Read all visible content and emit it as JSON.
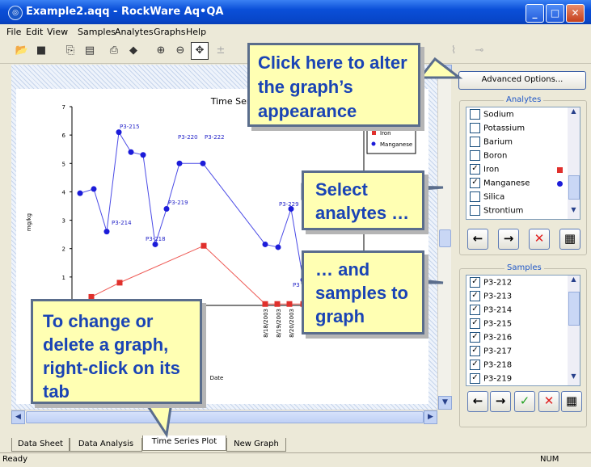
{
  "window": {
    "title": "Example2.aqq - RockWare Aq•QA",
    "app_icon": "RockWare compass logo",
    "min": "_",
    "max": "□",
    "close": "✕"
  },
  "menu": [
    "File",
    "Edit",
    "View",
    "Samples",
    "Analytes",
    "Graphs",
    "Help"
  ],
  "toolbar": {
    "icons": [
      "open-folder-icon",
      "save-icon",
      "copy-icon",
      "paste-icon",
      "print-icon",
      "eraser-icon",
      "zoom-in-icon",
      "zoom-out-icon",
      "pan-icon"
    ]
  },
  "chart_data": {
    "type": "line",
    "title": "Time Series Plot",
    "xlabel": "Date",
    "ylabel": "mg/kg",
    "ylim": [
      0,
      7
    ],
    "yticks": [
      "1",
      "2",
      "3",
      "4",
      "5",
      "6",
      "7"
    ],
    "x_tick_labels": [
      "8/18/2003",
      "8/19/2003",
      "8/20/2003"
    ],
    "legend": {
      "placement": "top-right",
      "entries": [
        "Iron",
        "Manganese"
      ]
    },
    "series": [
      {
        "name": "Manganese",
        "color": "#1c1cd9",
        "values": [
          3.95,
          4.1,
          2.6,
          6.1,
          5.4,
          5.3,
          2.15,
          3.4,
          5.0,
          5.0,
          2.15,
          2.05,
          3.4,
          0.9
        ]
      },
      {
        "name": "Iron",
        "color": "#e0302c",
        "values": [
          0.3,
          0.8,
          2.1,
          0.05,
          0.05,
          0.05,
          0.05
        ]
      }
    ],
    "point_labels": [
      "P3-214",
      "P3-215",
      "P3-218",
      "P3-219",
      "P3-220",
      "P3-222",
      "P3-229",
      "P3"
    ]
  },
  "sidebar": {
    "advanced_button": "Advanced Options...",
    "analytes_title": "Analytes",
    "analytes": [
      {
        "label": "Sodium",
        "checked": false,
        "marker": ""
      },
      {
        "label": "Potassium",
        "checked": false,
        "marker": ""
      },
      {
        "label": "Barium",
        "checked": false,
        "marker": ""
      },
      {
        "label": "Boron",
        "checked": false,
        "marker": ""
      },
      {
        "label": "Iron",
        "checked": true,
        "marker": "square-red"
      },
      {
        "label": "Manganese",
        "checked": true,
        "marker": "circle-blue"
      },
      {
        "label": "Silica",
        "checked": false,
        "marker": ""
      },
      {
        "label": "Strontium",
        "checked": false,
        "marker": ""
      }
    ],
    "analyte_buttons": [
      "←",
      "→",
      "✕",
      "▦"
    ],
    "samples_title": "Samples",
    "samples": [
      "P3-212",
      "P3-213",
      "P3-214",
      "P3-215",
      "P3-216",
      "P3-217",
      "P3-218",
      "P3-219"
    ],
    "sample_buttons": [
      "←",
      "→",
      "✓",
      "✕",
      "▦"
    ]
  },
  "tabs": [
    "Data Sheet",
    "Data Analysis",
    "Time Series Plot",
    "New Graph"
  ],
  "status": {
    "left": "Ready",
    "right": "NUM"
  },
  "callouts": {
    "appearance": "Click here to alter the graph’s appearance",
    "analytes": "Select analytes …",
    "samples": "… and samples to graph",
    "tabs": "To change or delete a graph, right-click on its tab"
  }
}
